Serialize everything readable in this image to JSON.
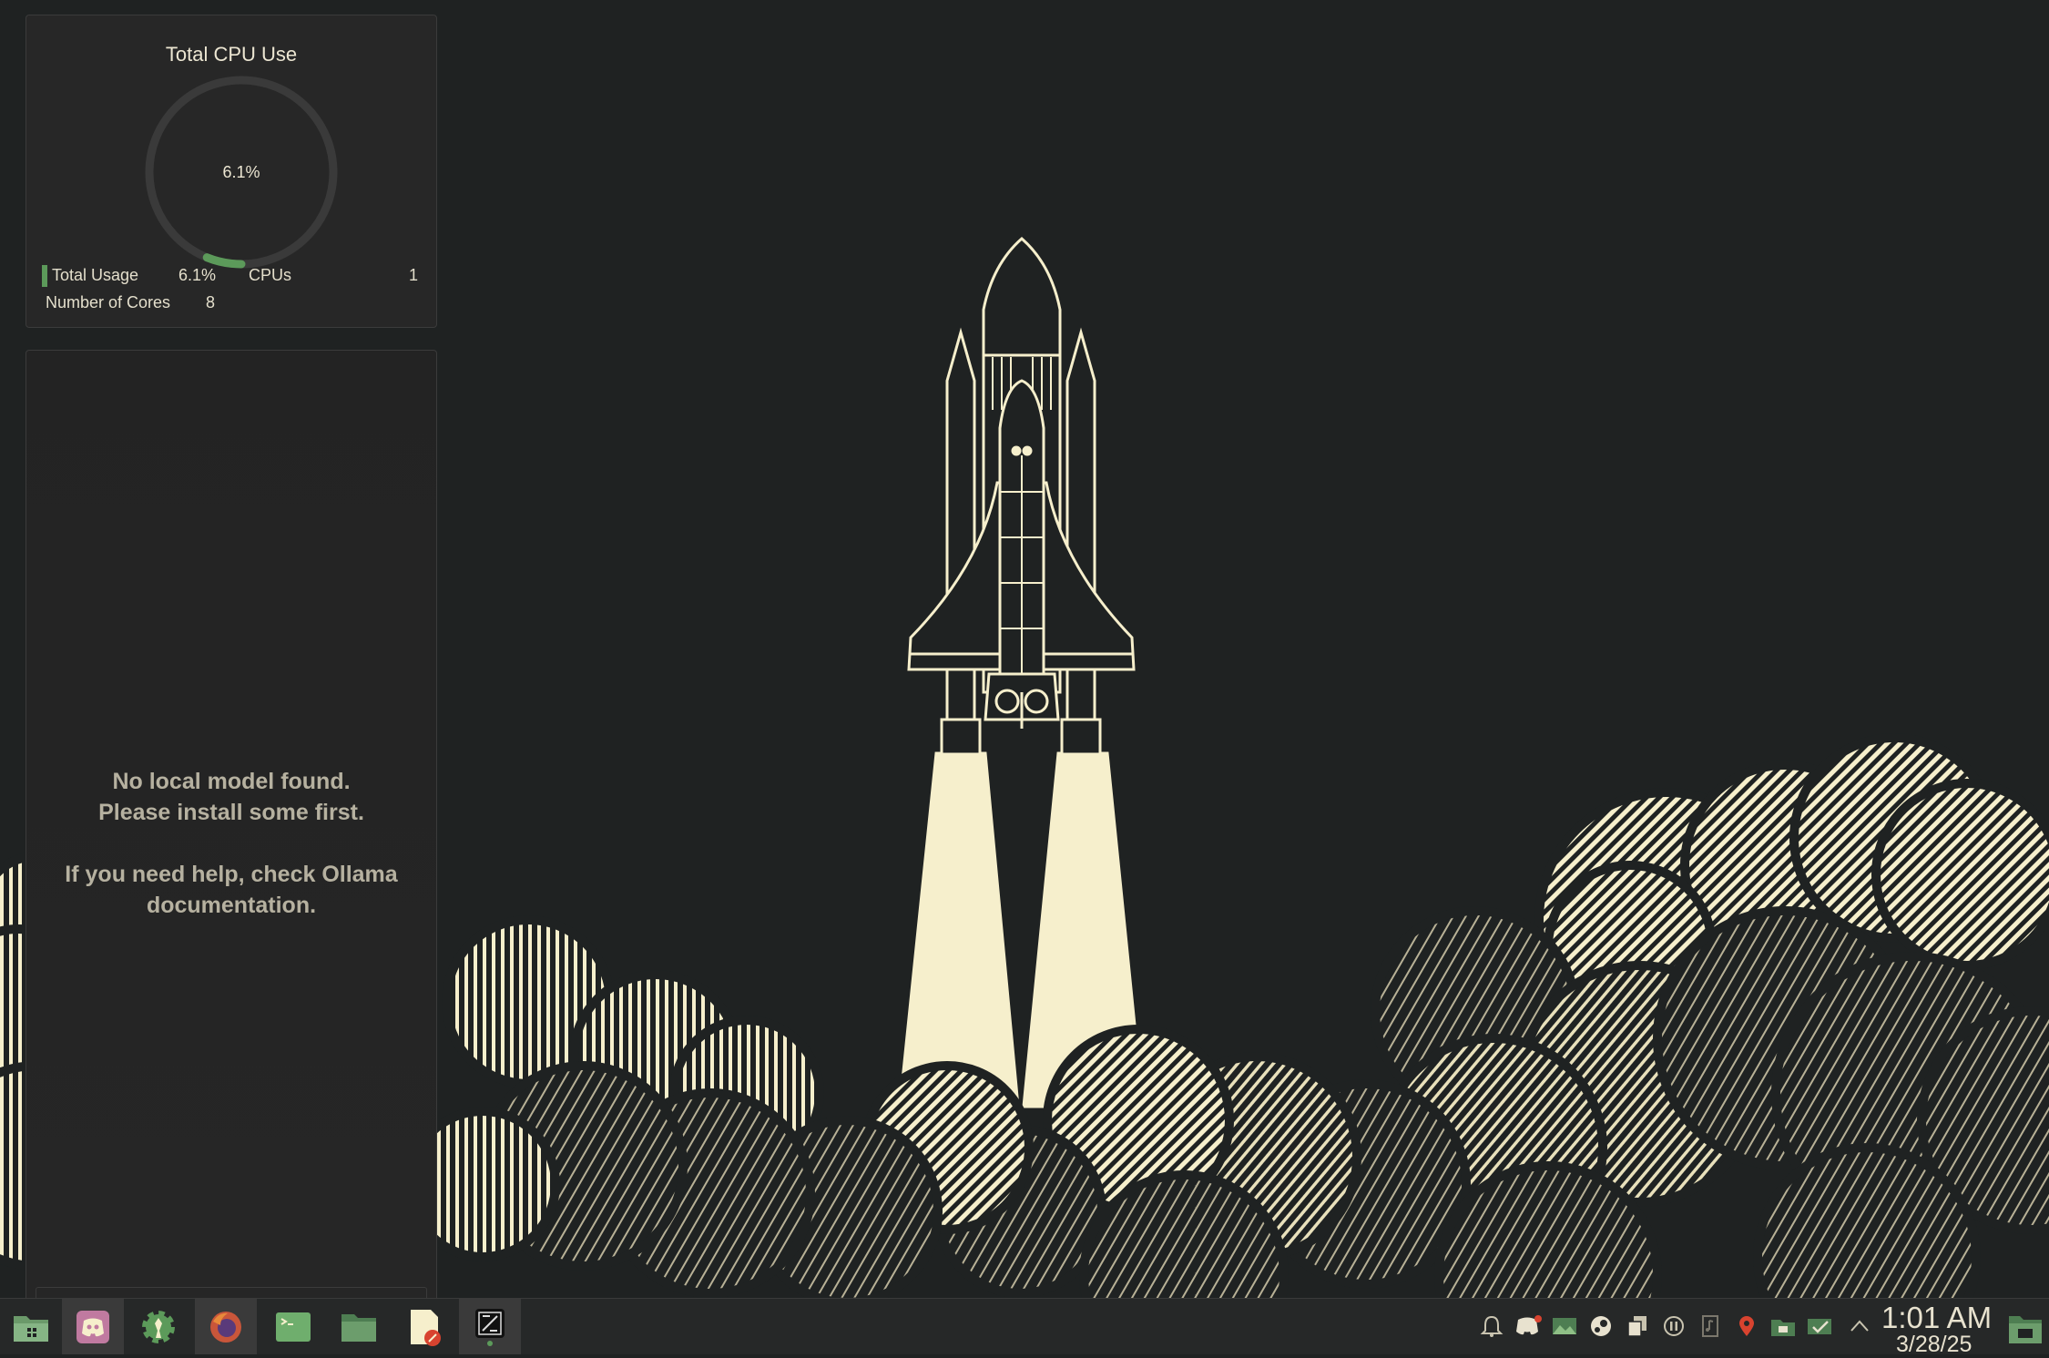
{
  "cpu_widget": {
    "title": "Total CPU Use",
    "gauge_value": "6.1%",
    "gauge_fraction": 0.061,
    "usage_label": "Total Usage",
    "usage_value": "6.1%",
    "cpus_label": "CPUs",
    "cpus_value": "1",
    "cores_label": "Number of Cores",
    "cores_value": "8",
    "accent_color": "#5c9a5a"
  },
  "ollama_widget": {
    "message_lines": [
      "No local model found.",
      "Please install some first.",
      "",
      "If you need help, check Ollama",
      "documentation."
    ]
  },
  "taskbar": {
    "tasks": [
      {
        "icon": "files-icon",
        "active": false
      },
      {
        "icon": "discord-icon",
        "active": true
      },
      {
        "icon": "settings-gear-icon",
        "active": false
      },
      {
        "icon": "firefox-icon",
        "active": true
      },
      {
        "icon": "terminal-icon",
        "active": false
      },
      {
        "icon": "folder-icon",
        "active": false
      },
      {
        "icon": "text-editor-icon",
        "active": false
      },
      {
        "icon": "code-editor-icon",
        "active": true
      }
    ],
    "tray": [
      "notifications-icon",
      "discord-tray-icon",
      "image-tray-icon",
      "steam-icon",
      "clipboard-icon",
      "pause-icon",
      "music-icon",
      "location-pin-icon",
      "network-icon",
      "updates-icon",
      "expand-tray-icon"
    ],
    "clock_time": "1:01 AM",
    "clock_date": "3/28/25"
  }
}
